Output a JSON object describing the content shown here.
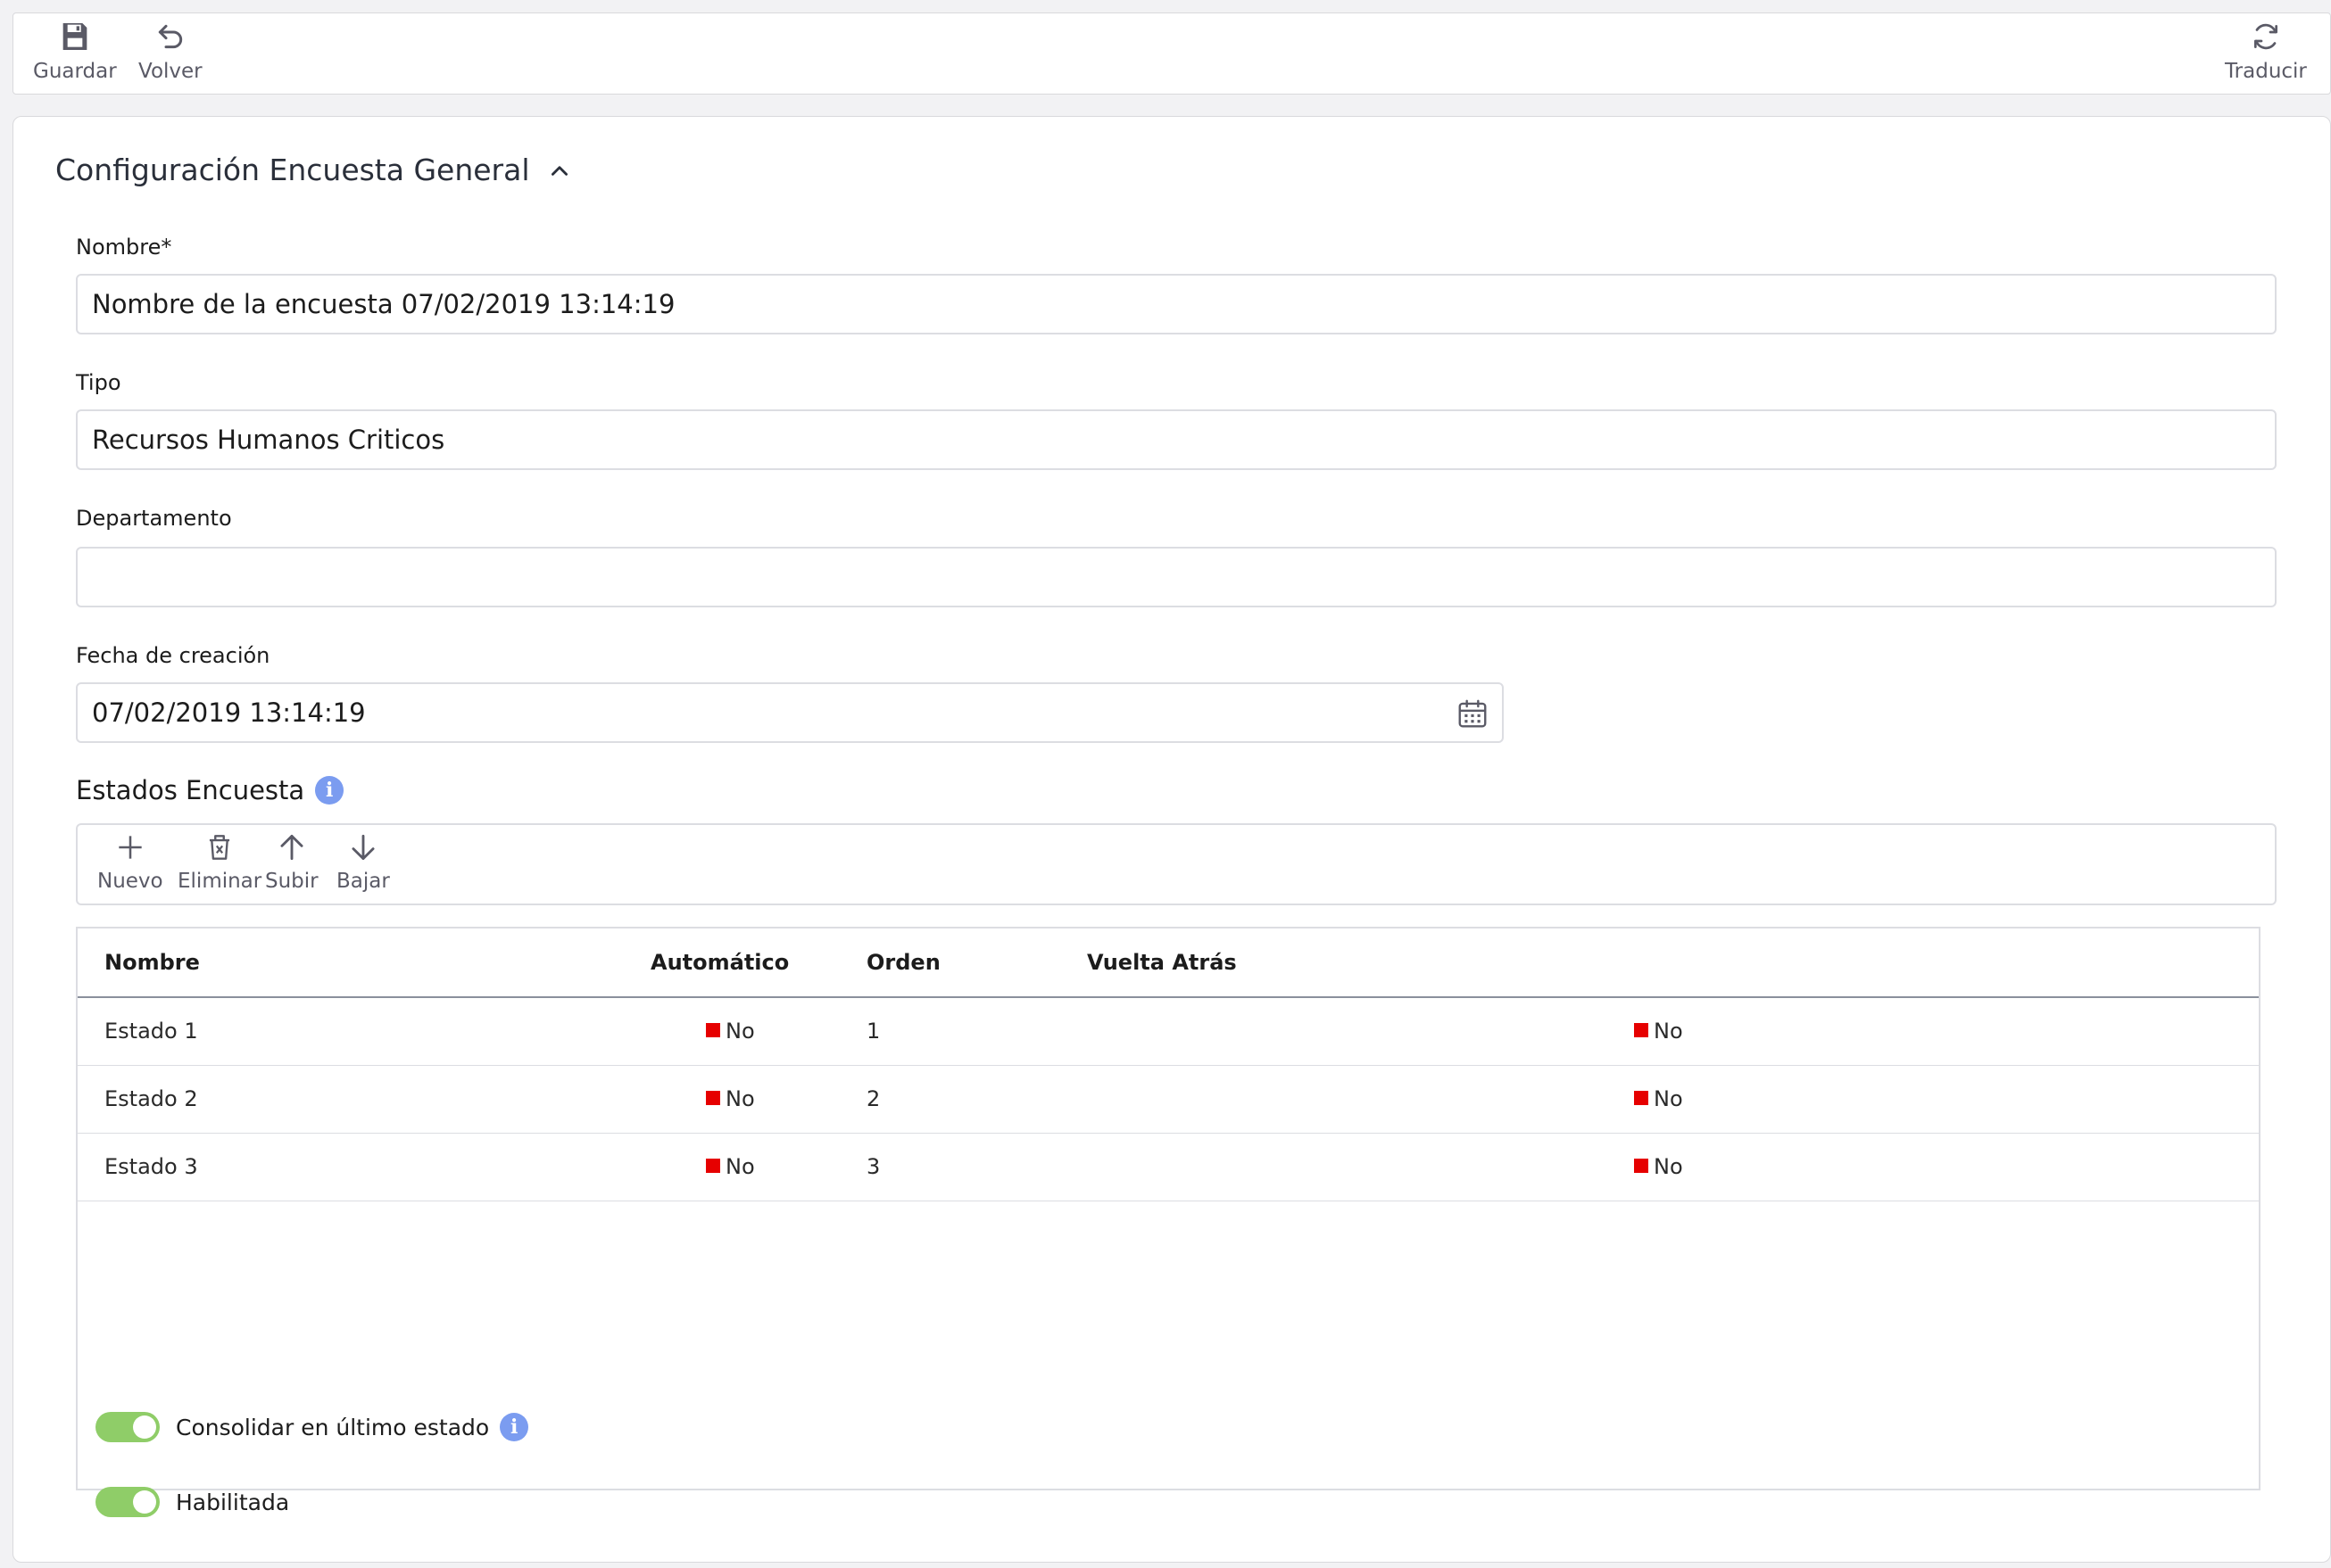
{
  "toolbar": {
    "save_label": "Guardar",
    "back_label": "Volver",
    "translate_label": "Traducir"
  },
  "card": {
    "title": "Configuración Encuesta General"
  },
  "form": {
    "nombre_label": "Nombre*",
    "nombre_value": "Nombre de la encuesta 07/02/2019 13:14:19",
    "tipo_label": "Tipo",
    "tipo_value": "Recursos Humanos Criticos",
    "departamento_label": "Departamento",
    "departamento_value": "",
    "fecha_label": "Fecha de creación",
    "fecha_value": "07/02/2019 13:14:19"
  },
  "estados": {
    "title": "Estados Encuesta",
    "toolbar": {
      "new_label": "Nuevo",
      "delete_label": "Eliminar",
      "up_label": "Subir",
      "down_label": "Bajar"
    },
    "columns": [
      "Nombre",
      "Automático",
      "Orden",
      "Vuelta Atrás"
    ],
    "rows": [
      {
        "nombre": "Estado 1",
        "automatico": "No",
        "orden": "1",
        "vuelta": "No"
      },
      {
        "nombre": "Estado 2",
        "automatico": "No",
        "orden": "2",
        "vuelta": "No"
      },
      {
        "nombre": "Estado 3",
        "automatico": "No",
        "orden": "3",
        "vuelta": "No"
      }
    ]
  },
  "toggles": {
    "consolidar_label": "Consolidar en último estado",
    "consolidar_on": true,
    "habilitada_label": "Habilitada",
    "habilitada_on": true
  },
  "colors": {
    "toggle_on": "#8fcd68",
    "flag_no": "#e60000",
    "info": "#7b9cf0"
  }
}
